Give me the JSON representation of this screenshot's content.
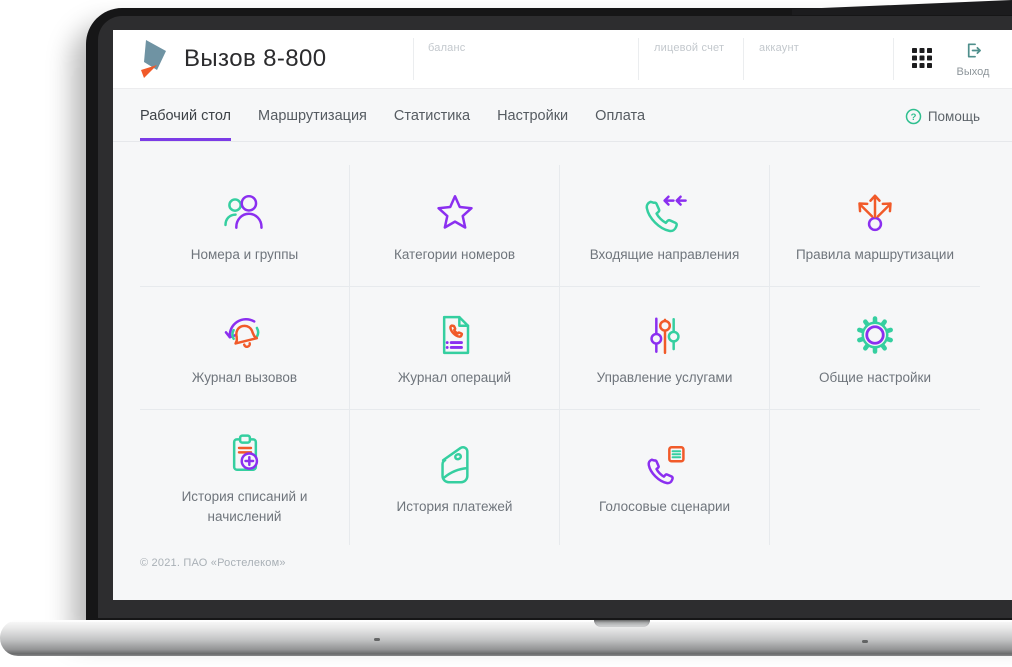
{
  "app": {
    "title": "Вызов 8-800"
  },
  "header": {
    "logo_icon": "brand-logo",
    "fields": [
      {
        "label": "баланс"
      },
      {
        "label": "лицевой счет"
      },
      {
        "label": "аккаунт"
      }
    ],
    "apps_icon": "apps-grid-icon",
    "logout_icon": "logout-icon",
    "logout_label": "Выход"
  },
  "nav": {
    "tabs": [
      {
        "label": "Рабочий стол",
        "active": true
      },
      {
        "label": "Маршрутизация",
        "active": false
      },
      {
        "label": "Статистика",
        "active": false
      },
      {
        "label": "Настройки",
        "active": false
      },
      {
        "label": "Оплата",
        "active": false
      }
    ],
    "help_icon": "help-icon",
    "help_label": "Помощь"
  },
  "tiles": [
    {
      "label": "Номера и группы",
      "icon": "users-icon"
    },
    {
      "label": "Категории номеров",
      "icon": "star-icon"
    },
    {
      "label": "Входящие направления",
      "icon": "incoming-call-icon"
    },
    {
      "label": "Правила маршрутизации",
      "icon": "routing-icon"
    },
    {
      "label": "Журнал вызовов",
      "icon": "call-log-icon"
    },
    {
      "label": "Журнал операций",
      "icon": "operations-log-icon"
    },
    {
      "label": "Управление услугами",
      "icon": "sliders-icon"
    },
    {
      "label": "Общие настройки",
      "icon": "gear-icon"
    },
    {
      "label": "История списаний и начислений",
      "icon": "charges-history-icon"
    },
    {
      "label": "История платежей",
      "icon": "payments-history-icon"
    },
    {
      "label": "Голосовые сценарии",
      "icon": "voice-scenarios-icon"
    }
  ],
  "footer": {
    "copyright": "© 2021. ПАО «Ростелеком»"
  },
  "colors": {
    "purple": "#8b2ff0",
    "green": "#35cfa0",
    "orange": "#f15a29",
    "teal": "#4f8f8c",
    "help": "#2fbf8f",
    "underline": "#7b3be6"
  }
}
